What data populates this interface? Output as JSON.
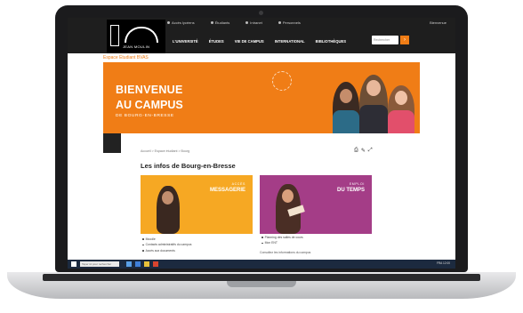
{
  "topbar": {
    "links": [
      "Accès lycéens",
      "Étudiants",
      "Intranet",
      "Personnels"
    ],
    "user": "Bienvenue"
  },
  "logo": {
    "text": "JEAN MOULIN"
  },
  "nav": {
    "items": [
      "L'UNIVERSITÉ",
      "ÉTUDES",
      "VIE DE CAMPUS",
      "INTERNATIONAL",
      "BIBLIOTHÈQUES"
    ]
  },
  "search": {
    "placeholder": "Rechercher"
  },
  "breadcrumb": {
    "label": "Espace Étudiant BVAS"
  },
  "hero": {
    "line1": "BIENVENUE",
    "line2": "AU CAMPUS",
    "line3": "DE BOURG-EN-BRESSE"
  },
  "subcrumb": "Accueil > Espace étudiant > Bourg",
  "page_title": "Les infos de Bourg-en-Bresse",
  "cards": {
    "mail": {
      "small": "ACCÈS",
      "big": "MESSAGERIE"
    },
    "time": {
      "small": "EMPLOI",
      "big": "DU TEMPS"
    }
  },
  "lists": {
    "left": [
      "Moodle",
      "Contacts administratifs du campus",
      "Accès aux documents"
    ],
    "right": [
      "Planning des salles de cours",
      "Mon ENT"
    ]
  },
  "note": "Consultez les informations du campus",
  "taskbar": {
    "search": "Taper ici pour rechercher",
    "tray": "FRA  12:00"
  },
  "colors": {
    "accent": "#f07d16",
    "mail": "#f6a823",
    "time": "#a43d87"
  }
}
